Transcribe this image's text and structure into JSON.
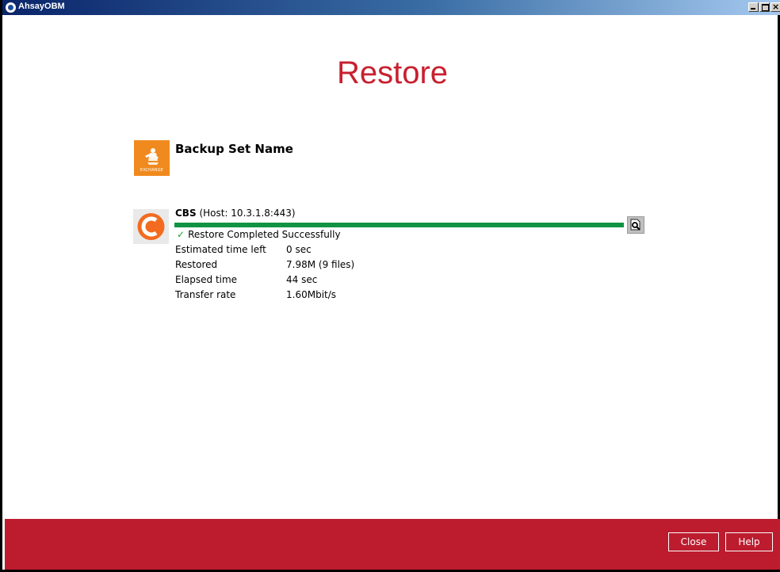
{
  "window": {
    "app_name": "AhsayOBM",
    "controls": {
      "minimize": "minimize-icon",
      "maximize": "maximize-icon",
      "close": "close-icon",
      "close_glyph": "×"
    }
  },
  "page": {
    "title": "Restore"
  },
  "backup_set": {
    "label": "Backup Set Name",
    "icon": "exchange-icon",
    "icon_caption": "EXCHANGE",
    "icon_color": "#f08a1e"
  },
  "destination": {
    "name": "CBS",
    "host": "(Host: 10.3.1.8:443)",
    "icon": "cbs-logo-icon",
    "progress_fraction": 1.0,
    "progress_color": "#109444",
    "status_icon": "check-icon",
    "status_text": "Restore Completed Successfully",
    "details_icon": "magnifier-icon",
    "stats": [
      {
        "label": "Estimated time left",
        "value": "0 sec"
      },
      {
        "label": "Restored",
        "value": "7.98M (9 files)"
      },
      {
        "label": "Elapsed time",
        "value": "44 sec"
      },
      {
        "label": "Transfer rate",
        "value": "1.60Mbit/s"
      }
    ]
  },
  "footer": {
    "color": "#bc1c2e",
    "close_label": "Close",
    "help_label": "Help"
  },
  "colors": {
    "accent": "#c8202f",
    "cbs_orange": "#f26b21"
  }
}
